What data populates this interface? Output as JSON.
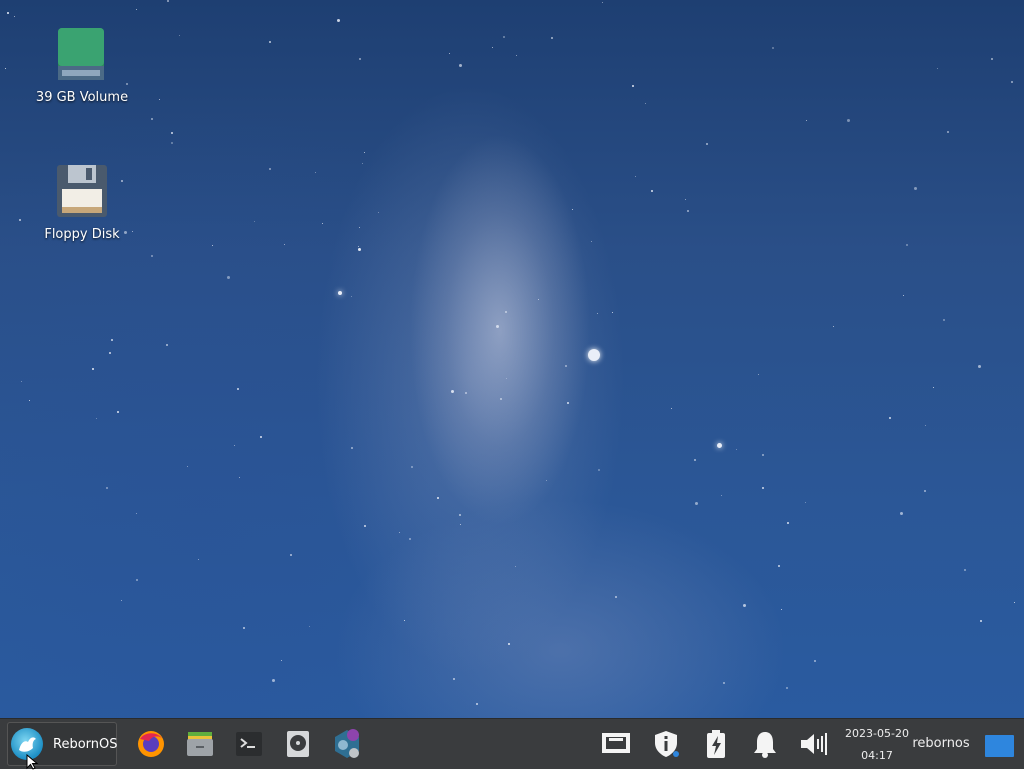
{
  "desktop": {
    "icons": [
      {
        "label": "39 GB Volume",
        "icon": "drive-icon"
      },
      {
        "label": "Floppy Disk",
        "icon": "floppy-disk-icon"
      }
    ]
  },
  "taskbar": {
    "start_label": "RebornOS",
    "launchers": [
      "firefox-icon",
      "file-manager-icon",
      "terminal-icon",
      "disk-utility-icon",
      "rebornos-tool-icon"
    ],
    "tray": [
      "network-icon",
      "security-info-icon",
      "power-icon",
      "notification-bell-icon",
      "volume-icon"
    ],
    "date": "2023-05-20",
    "time": "04:17",
    "user": "rebornos"
  },
  "colors": {
    "taskbar_bg": "#3a3c3e",
    "accent": "#2e86de"
  }
}
